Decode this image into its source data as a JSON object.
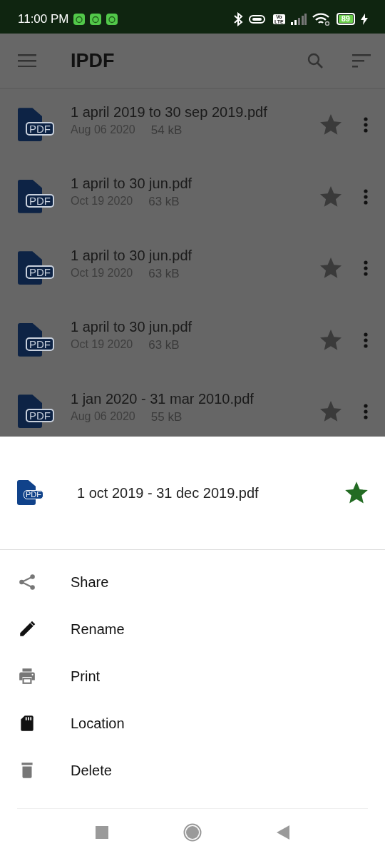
{
  "status_bar": {
    "time": "11:00 PM",
    "notifications": [
      {
        "kind": "app"
      },
      {
        "kind": "app"
      },
      {
        "kind": "app"
      }
    ],
    "volte": [
      "Vo",
      "LTE"
    ],
    "battery": "89"
  },
  "app_bar": {
    "title": "IPDF"
  },
  "files": [
    {
      "icon_label": "PDF",
      "name": "1 april 2019 to 30 sep 2019.pdf",
      "date": "Aug 06 2020",
      "size": "54 kB",
      "starred": false
    },
    {
      "icon_label": "PDF",
      "name": "1 april to 30 jun.pdf",
      "date": "Oct 19 2020",
      "size": "63 kB",
      "starred": false
    },
    {
      "icon_label": "PDF",
      "name": "1 april to 30 jun.pdf",
      "date": "Oct 19 2020",
      "size": "63 kB",
      "starred": false
    },
    {
      "icon_label": "PDF",
      "name": "1 april to 30 jun.pdf",
      "date": "Oct 19 2020",
      "size": "63 kB",
      "starred": false
    },
    {
      "icon_label": "PDF",
      "name": "1 jan 2020 - 31 mar 2010.pdf",
      "date": "Aug 06 2020",
      "size": "55 kB",
      "starred": false
    }
  ],
  "sheet": {
    "file": {
      "icon_label": "PDF",
      "name": "1 oct 2019 - 31 dec 2019.pdf",
      "starred": true
    },
    "actions": [
      {
        "kind": "share",
        "label": "Share"
      },
      {
        "kind": "rename",
        "label": "Rename"
      },
      {
        "kind": "print",
        "label": "Print"
      },
      {
        "kind": "location",
        "label": "Location"
      },
      {
        "kind": "delete",
        "label": "Delete"
      }
    ]
  }
}
